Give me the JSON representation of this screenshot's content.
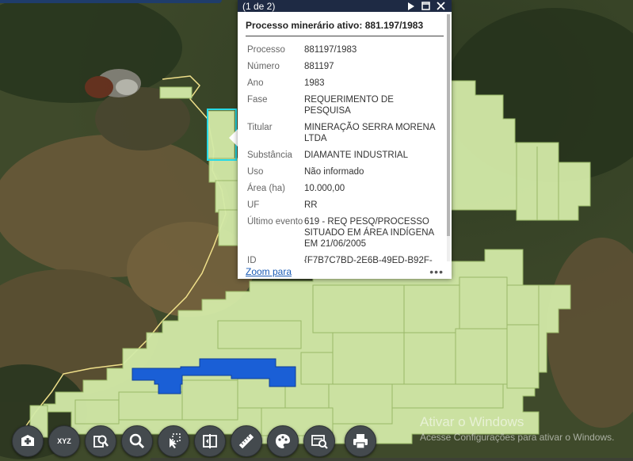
{
  "popup": {
    "counter": "(1 de 2)",
    "title": "Processo minerário ativo: 881.197/1983",
    "attributes": [
      {
        "label": "Processo",
        "value": "881197/1983"
      },
      {
        "label": "Número",
        "value": "881197"
      },
      {
        "label": "Ano",
        "value": "1983"
      },
      {
        "label": "Fase",
        "value": "REQUERIMENTO DE PESQUISA"
      },
      {
        "label": "Titular",
        "value": "MINERAÇÃO SERRA MORENA LTDA"
      },
      {
        "label": "Substância",
        "value": "DIAMANTE INDUSTRIAL"
      },
      {
        "label": "Uso",
        "value": "Não informado"
      },
      {
        "label": "Área (ha)",
        "value": "10.000,00"
      },
      {
        "label": "UF",
        "value": "RR"
      },
      {
        "label": "Último evento",
        "value": "619 - REQ PESQ/PROCESSO SITUADO EM ÁREA INDÍGENA EM 21/06/2005"
      },
      {
        "label": "ID",
        "value": "{F7B7C7BD-2E6B-49ED-B92F-"
      }
    ],
    "zoom_link": "Zoom para",
    "more": "•••",
    "icons": {
      "next": "play-icon",
      "maximize": "maximize-icon",
      "close": "close-icon"
    }
  },
  "toolbar": {
    "buttons": [
      {
        "name": "add-data-button",
        "icon": "add-data-icon"
      },
      {
        "name": "xyz-coordinates-button",
        "icon": "xyz-icon",
        "label": "XYZ"
      },
      {
        "name": "identify-button",
        "icon": "identify-icon"
      },
      {
        "name": "search-button",
        "icon": "search-icon"
      },
      {
        "name": "select-button",
        "icon": "select-icon"
      },
      {
        "name": "swipe-button",
        "icon": "swipe-icon"
      },
      {
        "name": "measure-button",
        "icon": "ruler-icon"
      },
      {
        "name": "basemap-button",
        "icon": "palette-icon"
      },
      {
        "name": "layer-list-button",
        "icon": "layers-icon"
      },
      {
        "name": "print-button",
        "icon": "printer-icon"
      }
    ]
  },
  "watermark": {
    "line1": "Ativar o Windows",
    "line2": "Acesse Configurações para ativar o Windows."
  },
  "colors": {
    "claim_fill": "#d3eaa8",
    "claim_stroke": "#9fbf6c",
    "selected_fill": "#1a5fd6",
    "boundary": "#f0e08a",
    "highlight": "#27d9e6",
    "popup_header": "#1e2a44"
  }
}
